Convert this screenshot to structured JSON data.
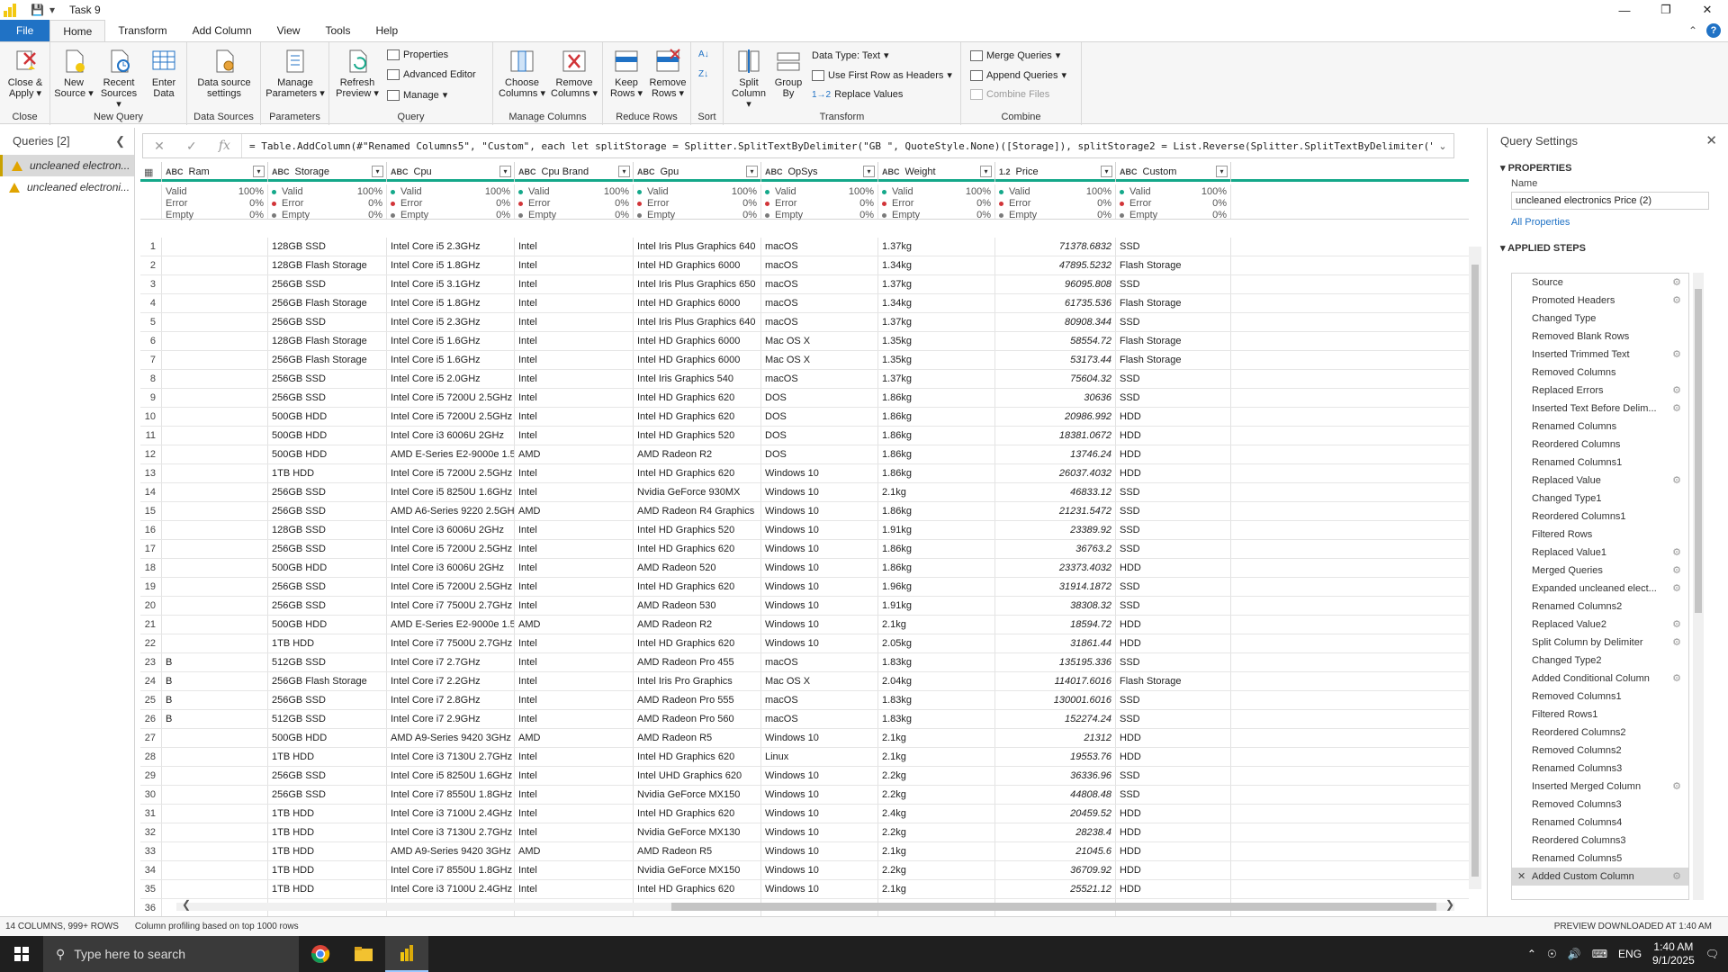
{
  "window": {
    "title": "Task 9"
  },
  "tabs": [
    {
      "label": "File",
      "kind": "file"
    },
    {
      "label": "Home",
      "kind": "active"
    },
    {
      "label": "Transform",
      "kind": ""
    },
    {
      "label": "Add Column",
      "kind": ""
    },
    {
      "label": "View",
      "kind": ""
    },
    {
      "label": "Tools",
      "kind": ""
    },
    {
      "label": "Help",
      "kind": ""
    }
  ],
  "ribbon": {
    "close_apply": "Close & Apply",
    "new_source": "New Source",
    "recent_sources": "Recent Sources",
    "enter_data": "Enter Data",
    "data_source_settings": "Data source settings",
    "manage_parameters": "Manage Parameters",
    "refresh_preview": "Refresh Preview",
    "properties": "Properties",
    "advanced_editor": "Advanced Editor",
    "manage": "Manage",
    "choose_columns": "Choose Columns",
    "remove_columns": "Remove Columns",
    "keep_rows": "Keep Rows",
    "remove_rows": "Remove Rows",
    "split_column": "Split Column",
    "group_by": "Group By",
    "data_type": "Data Type: Text",
    "use_first_row": "Use First Row as Headers",
    "replace_values": "Replace Values",
    "merge_queries": "Merge Queries",
    "append_queries": "Append Queries",
    "combine_files": "Combine Files",
    "groups": {
      "close": "Close",
      "new_query": "New Query",
      "data_sources": "Data Sources",
      "parameters": "Parameters",
      "query": "Query",
      "manage_columns": "Manage Columns",
      "reduce_rows": "Reduce Rows",
      "sort": "Sort",
      "transform": "Transform",
      "combine": "Combine"
    }
  },
  "formula": {
    "text": "= Table.AddColumn(#\"Renamed Columns5\", \"Custom\", each let splitStorage = Splitter.SplitTextByDelimiter(\"GB \", QuoteStyle.None)([Storage]), splitStorage2 = List.Reverse(Splitter.SplitTextByDelimiter(\" \","
  },
  "queries": {
    "header": "Queries [2]",
    "items": [
      "uncleaned electron...",
      "uncleaned electroni..."
    ]
  },
  "columns": [
    {
      "type": "ABC",
      "name": "Ram"
    },
    {
      "type": "ABC",
      "name": "Storage"
    },
    {
      "type": "ABC",
      "name": "Cpu"
    },
    {
      "type": "ABC",
      "name": "Cpu Brand"
    },
    {
      "type": "ABC",
      "name": "Gpu"
    },
    {
      "type": "ABC",
      "name": "OpSys"
    },
    {
      "type": "ABC",
      "name": "Weight"
    },
    {
      "type": "1.2",
      "name": "Price"
    },
    {
      "type": "ABC",
      "name": "Custom"
    }
  ],
  "profile": {
    "valid": "Valid",
    "error": "Error",
    "empty": "Empty",
    "valid_pct": "100%",
    "error_pct": "0%",
    "empty_pct": "0%",
    "ram_valid": "Valid",
    "ram_error": "Error",
    "ram_empty": "Empty",
    "colors": {
      "valid": "#14a88a",
      "error": "#d13438",
      "empty": "#7a7a7a"
    }
  },
  "rows": [
    [
      "1",
      "",
      "128GB SSD",
      "Intel Core i5 2.3GHz",
      "Intel",
      "Intel Iris Plus Graphics 640",
      "macOS",
      "1.37kg",
      "71378.6832",
      "SSD"
    ],
    [
      "2",
      "",
      "128GB Flash Storage",
      "Intel Core i5 1.8GHz",
      "Intel",
      "Intel HD Graphics 6000",
      "macOS",
      "1.34kg",
      "47895.5232",
      "Flash Storage"
    ],
    [
      "3",
      "",
      "256GB SSD",
      "Intel Core i5 3.1GHz",
      "Intel",
      "Intel Iris Plus Graphics 650",
      "macOS",
      "1.37kg",
      "96095.808",
      "SSD"
    ],
    [
      "4",
      "",
      "256GB Flash Storage",
      "Intel Core i5 1.8GHz",
      "Intel",
      "Intel HD Graphics 6000",
      "macOS",
      "1.34kg",
      "61735.536",
      "Flash Storage"
    ],
    [
      "5",
      "",
      "256GB SSD",
      "Intel Core i5 2.3GHz",
      "Intel",
      "Intel Iris Plus Graphics 640",
      "macOS",
      "1.37kg",
      "80908.344",
      "SSD"
    ],
    [
      "6",
      "",
      "128GB Flash Storage",
      "Intel Core i5 1.6GHz",
      "Intel",
      "Intel HD Graphics 6000",
      "Mac OS X",
      "1.35kg",
      "58554.72",
      "Flash Storage"
    ],
    [
      "7",
      "",
      "256GB Flash Storage",
      "Intel Core i5 1.6GHz",
      "Intel",
      "Intel HD Graphics 6000",
      "Mac OS X",
      "1.35kg",
      "53173.44",
      "Flash Storage"
    ],
    [
      "8",
      "",
      "256GB SSD",
      "Intel Core i5 2.0GHz",
      "Intel",
      "Intel Iris Graphics 540",
      "macOS",
      "1.37kg",
      "75604.32",
      "SSD"
    ],
    [
      "9",
      "",
      "256GB SSD",
      "Intel Core i5 7200U 2.5GHz",
      "Intel",
      "Intel HD Graphics 620",
      "DOS",
      "1.86kg",
      "30636",
      "SSD"
    ],
    [
      "10",
      "",
      "500GB HDD",
      "Intel Core i5 7200U 2.5GHz",
      "Intel",
      "Intel HD Graphics 620",
      "DOS",
      "1.86kg",
      "20986.992",
      "HDD"
    ],
    [
      "11",
      "",
      "500GB HDD",
      "Intel Core i3 6006U 2GHz",
      "Intel",
      "Intel HD Graphics 520",
      "DOS",
      "1.86kg",
      "18381.0672",
      "HDD"
    ],
    [
      "12",
      "",
      "500GB HDD",
      "AMD E-Series E2-9000e 1.5GHz",
      "AMD",
      "AMD Radeon R2",
      "DOS",
      "1.86kg",
      "13746.24",
      "HDD"
    ],
    [
      "13",
      "",
      "1TB HDD",
      "Intel Core i5 7200U 2.5GHz",
      "Intel",
      "Intel HD Graphics 620",
      "Windows 10",
      "1.86kg",
      "26037.4032",
      "HDD"
    ],
    [
      "14",
      "",
      "256GB SSD",
      "Intel Core i5 8250U 1.6GHz",
      "Intel",
      "Nvidia GeForce 930MX",
      "Windows 10",
      "2.1kg",
      "46833.12",
      "SSD"
    ],
    [
      "15",
      "",
      "256GB SSD",
      "AMD A6-Series 9220 2.5GHz",
      "AMD",
      "AMD Radeon R4 Graphics",
      "Windows 10",
      "1.86kg",
      "21231.5472",
      "SSD"
    ],
    [
      "16",
      "",
      "128GB SSD",
      "Intel Core i3 6006U 2GHz",
      "Intel",
      "Intel HD Graphics 520",
      "Windows 10",
      "1.91kg",
      "23389.92",
      "SSD"
    ],
    [
      "17",
      "",
      "256GB SSD",
      "Intel Core i5 7200U 2.5GHz",
      "Intel",
      "Intel HD Graphics 620",
      "Windows 10",
      "1.86kg",
      "36763.2",
      "SSD"
    ],
    [
      "18",
      "",
      "500GB HDD",
      "Intel Core i3 6006U 2GHz",
      "Intel",
      "AMD Radeon 520",
      "Windows 10",
      "1.86kg",
      "23373.4032",
      "HDD"
    ],
    [
      "19",
      "",
      "256GB SSD",
      "Intel Core i5 7200U 2.5GHz",
      "Intel",
      "Intel HD Graphics 620",
      "Windows 10",
      "1.96kg",
      "31914.1872",
      "SSD"
    ],
    [
      "20",
      "",
      "256GB SSD",
      "Intel Core i7 7500U 2.7GHz",
      "Intel",
      "AMD Radeon 530",
      "Windows 10",
      "1.91kg",
      "38308.32",
      "SSD"
    ],
    [
      "21",
      "",
      "500GB HDD",
      "AMD E-Series E2-9000e 1.5GHz",
      "AMD",
      "AMD Radeon R2",
      "Windows 10",
      "2.1kg",
      "18594.72",
      "HDD"
    ],
    [
      "22",
      "",
      "1TB HDD",
      "Intel Core i7 7500U 2.7GHz",
      "Intel",
      "Intel HD Graphics 620",
      "Windows 10",
      "2.05kg",
      "31861.44",
      "HDD"
    ],
    [
      "23",
      "B",
      "512GB SSD",
      "Intel Core i7 2.7GHz",
      "Intel",
      "AMD Radeon Pro 455",
      "macOS",
      "1.83kg",
      "135195.336",
      "SSD"
    ],
    [
      "24",
      "B",
      "256GB Flash Storage",
      "Intel Core i7 2.2GHz",
      "Intel",
      "Intel Iris Pro Graphics",
      "Mac OS X",
      "2.04kg",
      "114017.6016",
      "Flash Storage"
    ],
    [
      "25",
      "B",
      "256GB SSD",
      "Intel Core i7 2.8GHz",
      "Intel",
      "AMD Radeon Pro 555",
      "macOS",
      "1.83kg",
      "130001.6016",
      "SSD"
    ],
    [
      "26",
      "B",
      "512GB SSD",
      "Intel Core i7 2.9GHz",
      "Intel",
      "AMD Radeon Pro 560",
      "macOS",
      "1.83kg",
      "152274.24",
      "SSD"
    ],
    [
      "27",
      "",
      "500GB HDD",
      "AMD A9-Series 9420 3GHz",
      "AMD",
      "AMD Radeon R5",
      "Windows 10",
      "2.1kg",
      "21312",
      "HDD"
    ],
    [
      "28",
      "",
      "1TB HDD",
      "Intel Core i3 7130U 2.7GHz",
      "Intel",
      "Intel HD Graphics 620",
      "Linux",
      "2.1kg",
      "19553.76",
      "HDD"
    ],
    [
      "29",
      "",
      "256GB SSD",
      "Intel Core i5 8250U 1.6GHz",
      "Intel",
      "Intel UHD Graphics 620",
      "Windows 10",
      "2.2kg",
      "36336.96",
      "SSD"
    ],
    [
      "30",
      "",
      "256GB SSD",
      "Intel Core i7 8550U 1.8GHz",
      "Intel",
      "Nvidia GeForce MX150",
      "Windows 10",
      "2.2kg",
      "44808.48",
      "SSD"
    ],
    [
      "31",
      "",
      "1TB HDD",
      "Intel Core i3 7100U 2.4GHz",
      "Intel",
      "Intel HD Graphics 620",
      "Windows 10",
      "2.4kg",
      "20459.52",
      "HDD"
    ],
    [
      "32",
      "",
      "1TB HDD",
      "Intel Core i3 7130U 2.7GHz",
      "Intel",
      "Nvidia GeForce MX130",
      "Windows 10",
      "2.2kg",
      "28238.4",
      "HDD"
    ],
    [
      "33",
      "",
      "1TB HDD",
      "AMD A9-Series 9420 3GHz",
      "AMD",
      "AMD Radeon R5",
      "Windows 10",
      "2.1kg",
      "21045.6",
      "HDD"
    ],
    [
      "34",
      "",
      "1TB HDD",
      "Intel Core i7 8550U 1.8GHz",
      "Intel",
      "Nvidia GeForce MX150",
      "Windows 10",
      "2.2kg",
      "36709.92",
      "HDD"
    ],
    [
      "35",
      "",
      "1TB HDD",
      "Intel Core i3 7100U 2.4GHz",
      "Intel",
      "Intel HD Graphics 620",
      "Windows 10",
      "2.1kg",
      "25521.12",
      "HDD"
    ],
    [
      "36",
      "",
      "",
      "",
      "",
      "",
      "",
      "",
      "",
      ""
    ]
  ],
  "settings": {
    "header": "Query Settings",
    "properties": "PROPERTIES",
    "name_label": "Name",
    "name_value": "uncleaned electronics Price (2)",
    "all_properties": "All Properties",
    "applied_steps": "APPLIED STEPS",
    "steps": [
      {
        "label": "Source",
        "gear": true
      },
      {
        "label": "Promoted Headers",
        "gear": true
      },
      {
        "label": "Changed Type",
        "gear": false
      },
      {
        "label": "Removed Blank Rows",
        "gear": false
      },
      {
        "label": "Inserted Trimmed Text",
        "gear": true
      },
      {
        "label": "Removed Columns",
        "gear": false
      },
      {
        "label": "Replaced Errors",
        "gear": true
      },
      {
        "label": "Inserted Text Before Delim...",
        "gear": true
      },
      {
        "label": "Renamed Columns",
        "gear": false
      },
      {
        "label": "Reordered Columns",
        "gear": false
      },
      {
        "label": "Renamed Columns1",
        "gear": false
      },
      {
        "label": "Replaced Value",
        "gear": true
      },
      {
        "label": "Changed Type1",
        "gear": false
      },
      {
        "label": "Reordered Columns1",
        "gear": false
      },
      {
        "label": "Filtered Rows",
        "gear": false
      },
      {
        "label": "Replaced Value1",
        "gear": true
      },
      {
        "label": "Merged Queries",
        "gear": true
      },
      {
        "label": "Expanded uncleaned elect...",
        "gear": true
      },
      {
        "label": "Renamed Columns2",
        "gear": false
      },
      {
        "label": "Replaced Value2",
        "gear": true
      },
      {
        "label": "Split Column by Delimiter",
        "gear": true
      },
      {
        "label": "Changed Type2",
        "gear": false
      },
      {
        "label": "Added Conditional Column",
        "gear": true
      },
      {
        "label": "Removed Columns1",
        "gear": false
      },
      {
        "label": "Filtered Rows1",
        "gear": false
      },
      {
        "label": "Reordered Columns2",
        "gear": false
      },
      {
        "label": "Removed Columns2",
        "gear": false
      },
      {
        "label": "Renamed Columns3",
        "gear": false
      },
      {
        "label": "Inserted Merged Column",
        "gear": true
      },
      {
        "label": "Removed Columns3",
        "gear": false
      },
      {
        "label": "Renamed Columns4",
        "gear": false
      },
      {
        "label": "Reordered Columns3",
        "gear": false
      },
      {
        "label": "Renamed Columns5",
        "gear": false
      },
      {
        "label": "Added Custom Column",
        "gear": true,
        "selected": true
      }
    ]
  },
  "status": {
    "columns_rows": "14 COLUMNS, 999+ ROWS",
    "profiling": "Column profiling based on top 1000 rows",
    "preview": "PREVIEW DOWNLOADED AT 1:40 AM"
  },
  "taskbar": {
    "search_placeholder": "Type here to search",
    "lang": "ENG",
    "time": "1:40 AM",
    "date": "9/1/2025"
  },
  "colors": {
    "accent": "#2072c5",
    "profile_bar": "#14a88a",
    "pbi_yellow": "#f2c811"
  }
}
